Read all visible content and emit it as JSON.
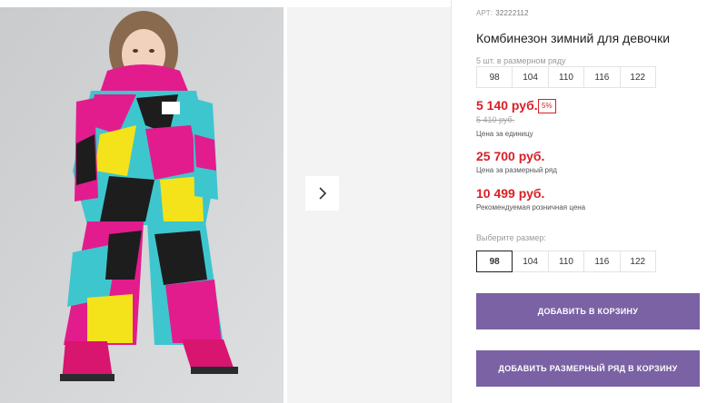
{
  "product": {
    "article_label": "АРТ:",
    "article_code": "32222112",
    "title": "Комбинезон зимний для девочки",
    "pack_note": "5 шт. в размерном ряду",
    "pack_sizes": [
      "98",
      "104",
      "110",
      "116",
      "122"
    ]
  },
  "pricing": {
    "unit_price": "5 140 руб.",
    "discount_badge": "5%",
    "old_price": "5 410 руб.",
    "unit_caption": "Цена за единицу",
    "row_price": "25 700 руб.",
    "row_caption": "Цена за размерный ряд",
    "retail_price": "10 499 руб.",
    "retail_caption": "Рекомендуемая розничная цена"
  },
  "size_picker": {
    "label": "Выберите размер:",
    "options": [
      "98",
      "104",
      "110",
      "116",
      "122"
    ],
    "selected": "98"
  },
  "actions": {
    "add_to_cart": "ДОБАВИТЬ В КОРЗИНУ",
    "add_row_to_cart": "ДОБАВИТЬ РАЗМЕРНЫЙ РЯД В КОРЗИНУ"
  },
  "gallery": {
    "next_icon": "chevron-right-icon"
  },
  "colors": {
    "price_red": "#d81f26",
    "button_purple": "#7a62a4"
  }
}
